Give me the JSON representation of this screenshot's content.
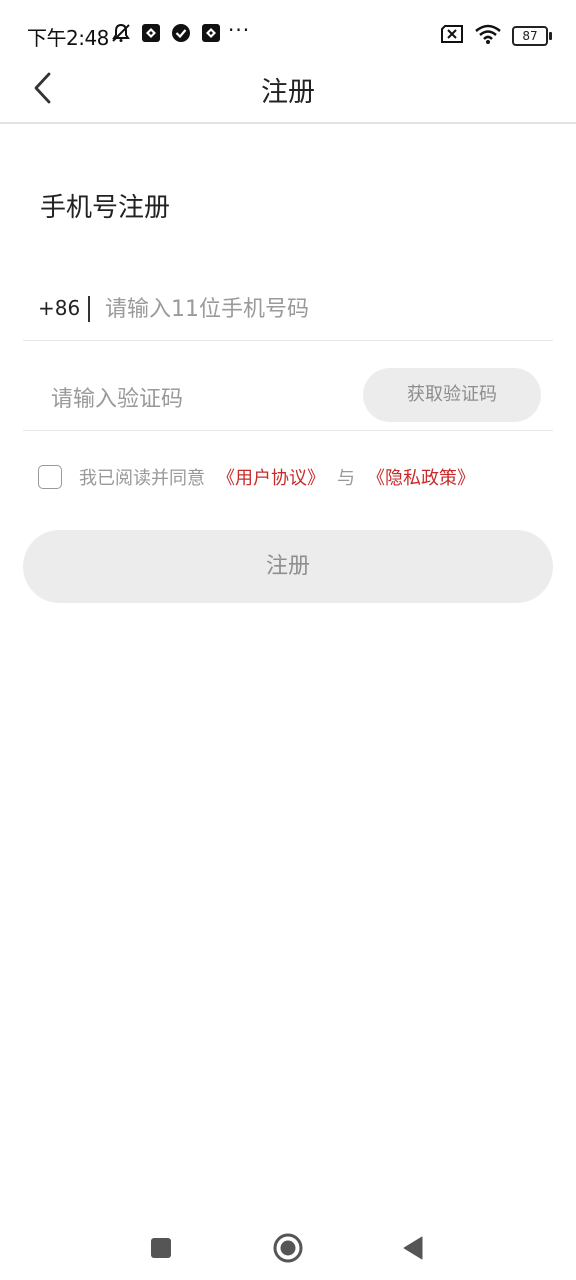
{
  "status_bar": {
    "time": "下午2:48",
    "more": "···",
    "battery": "87"
  },
  "header": {
    "title": "注册"
  },
  "form": {
    "section_title": "手机号注册",
    "country_code": "+86",
    "phone_placeholder": "请输入11位手机号码",
    "phone_value": "",
    "code_placeholder": "请输入验证码",
    "code_value": "",
    "get_code_label": "获取验证码",
    "agree_prefix": "我已阅读并同意",
    "user_agreement": "《用户协议》",
    "conjunction": "与",
    "privacy_policy": "《隐私政策》",
    "submit_label": "注册"
  },
  "colors": {
    "link": "#c92b2b",
    "button_bg": "#ececec",
    "button_text": "#8e8e8e"
  }
}
